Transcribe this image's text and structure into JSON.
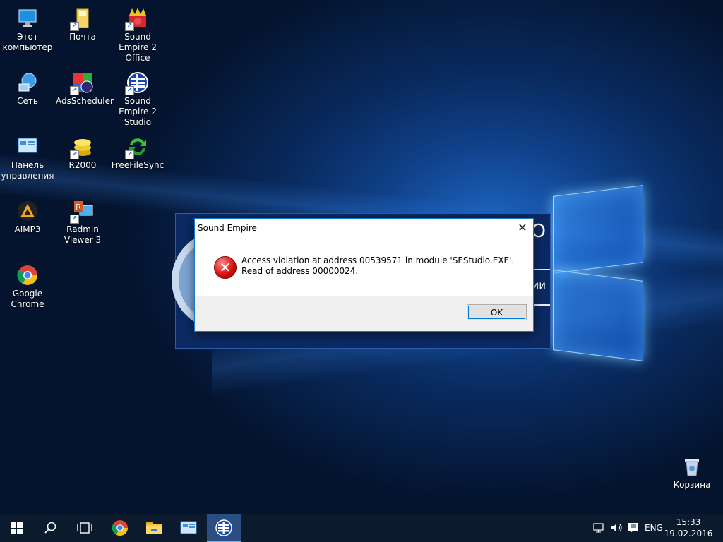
{
  "desktop": {
    "icons": [
      {
        "label": "Этот компьютер"
      },
      {
        "label": "Почта"
      },
      {
        "label": "Sound Empire 2 Office"
      },
      {
        "label": "Сеть"
      },
      {
        "label": "AdsScheduler"
      },
      {
        "label": "Sound Empire 2 Studio"
      },
      {
        "label": "Панель управления"
      },
      {
        "label": "R2000"
      },
      {
        "label": "FreeFileSync"
      },
      {
        "label": "AIMP3"
      },
      {
        "label": "Radmin Viewer 3"
      },
      {
        "label": "Google Chrome"
      },
      {
        "label": "Корзина"
      }
    ]
  },
  "background_window": {
    "partial_text_top": "O",
    "partial_text_side": "ии"
  },
  "dialog": {
    "title": "Sound Empire",
    "message": "Access violation at address 00539571 in module 'SEStudio.EXE'. Read of address 00000024.",
    "ok_label": "OK",
    "close_glyph": "✕"
  },
  "taskbar": {
    "language": "ENG",
    "time": "15:33",
    "date": "19.02.2016",
    "colors": {
      "background": "#0c1a2e",
      "active": "#2a4e82",
      "indicator": "#76b9ed"
    }
  }
}
